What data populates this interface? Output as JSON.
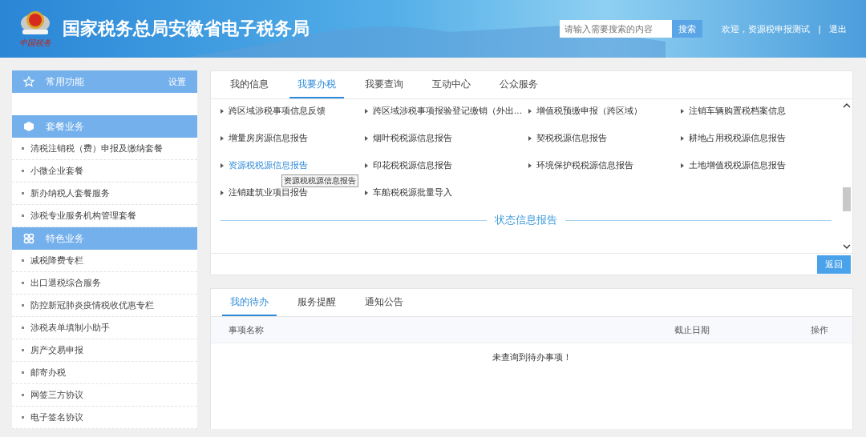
{
  "header": {
    "title": "国家税务总局安徽省电子税务局",
    "logo_caption": "中国税务",
    "search": {
      "placeholder": "请输入需要搜索的内容",
      "button": "搜索"
    },
    "welcome": "欢迎，资源税申报测试",
    "separator": "|",
    "logout": "退出"
  },
  "sidebar": {
    "sections": [
      {
        "kind": "star",
        "title": "常用功能",
        "action": "设置"
      },
      {
        "kind": "cube",
        "title": "套餐业务",
        "items": [
          "清税注销税（费）申报及缴纳套餐",
          "小微企业套餐",
          "新办纳税人套餐服务",
          "涉税专业服务机构管理套餐"
        ]
      },
      {
        "kind": "flower",
        "title": "特色业务",
        "items": [
          "减税降费专栏",
          "出口退税综合服务",
          "防控新冠肺炎疫情税收优惠专栏",
          "涉税表单填制小助手",
          "房产交易申报",
          "邮寄办税",
          "网签三方协议",
          "电子签名协议"
        ]
      }
    ]
  },
  "main_tabs": [
    {
      "label": "我的信息",
      "selected": false
    },
    {
      "label": "我要办税",
      "selected": true
    },
    {
      "label": "我要查询",
      "selected": false
    },
    {
      "label": "互动中心",
      "selected": false
    },
    {
      "label": "公众服务",
      "selected": false
    }
  ],
  "links": [
    {
      "label": "跨区域涉税事项信息反馈",
      "hovered": false
    },
    {
      "label": "跨区域涉税事项报验登记缴销（外出...",
      "hovered": false
    },
    {
      "label": "增值税预缴申报（跨区域）",
      "hovered": false
    },
    {
      "label": "注销车辆购置税档案信息",
      "hovered": false
    },
    {
      "label": "增量房房源信息报告",
      "hovered": false
    },
    {
      "label": "烟叶税税源信息报告",
      "hovered": false
    },
    {
      "label": "契税税源信息报告",
      "hovered": false
    },
    {
      "label": "耕地占用税税源信息报告",
      "hovered": false
    },
    {
      "label": "资源税税源信息报告",
      "hovered": true
    },
    {
      "label": "印花税税源信息报告",
      "hovered": false
    },
    {
      "label": "环境保护税税源信息报告",
      "hovered": false
    },
    {
      "label": "土地增值税税源信息报告",
      "hovered": false
    },
    {
      "label": "注销建筑业项目报告",
      "hovered": false
    },
    {
      "label": "车船税税源批量导入",
      "hovered": false
    }
  ],
  "tooltip": "资源税税源信息报告",
  "section_heading": "状态信息报告",
  "back_button": "返回",
  "todo_tabs": [
    {
      "label": "我的待办",
      "selected": true
    },
    {
      "label": "服务提醒",
      "selected": false
    },
    {
      "label": "通知公告",
      "selected": false
    }
  ],
  "todo_table": {
    "columns": [
      "事项名称",
      "截止日期",
      "操作"
    ],
    "empty_message": "未查询到待办事项！"
  }
}
